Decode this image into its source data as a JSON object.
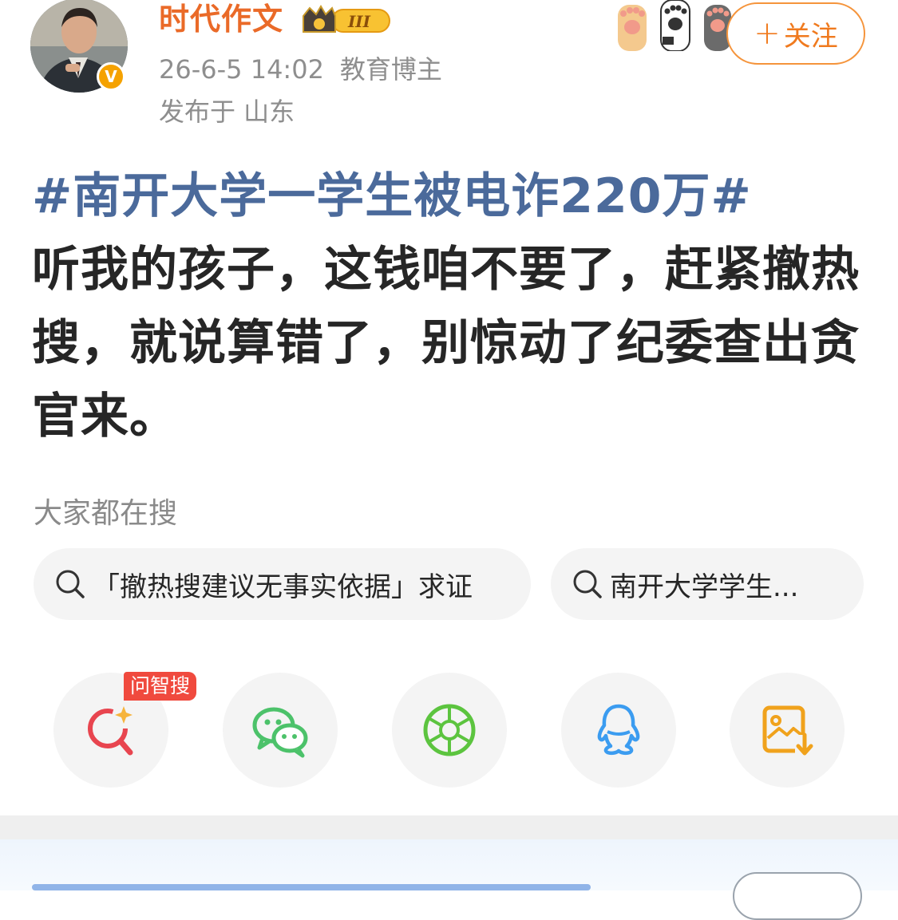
{
  "header": {
    "username": "时代作文",
    "level_badge": "III",
    "date": "26-6-5 14:02",
    "role": "教育博主",
    "location": "发布于 山东",
    "follow_label": "关注",
    "follow_plus": "+"
  },
  "post": {
    "hashtag": "#南开大学一学生被电诈220万#",
    "text": "听我的孩子，这钱咱不要了，赶紧撤热搜，就说算错了，别惊动了纪委查出贪官来。"
  },
  "search": {
    "label": "大家都在搜",
    "chips": [
      {
        "text": "「撤热搜建议无事实依据」求证"
      },
      {
        "text": "南开大学学生..."
      }
    ]
  },
  "share": {
    "badge": "问智搜",
    "items": [
      {
        "icon": "wenzhisou-icon",
        "color": "#e8454f"
      },
      {
        "icon": "wechat-icon",
        "color": "#4cc26a"
      },
      {
        "icon": "moments-icon",
        "color": "#5cc43f"
      },
      {
        "icon": "qq-icon",
        "color": "#3b9cf0"
      },
      {
        "icon": "save-image-icon",
        "color": "#f0a21c"
      }
    ]
  },
  "colors": {
    "username": "#ea6a28",
    "hashtag": "#4b6a9b",
    "follow": "#f07a1e",
    "meta": "#8e8e8e"
  }
}
